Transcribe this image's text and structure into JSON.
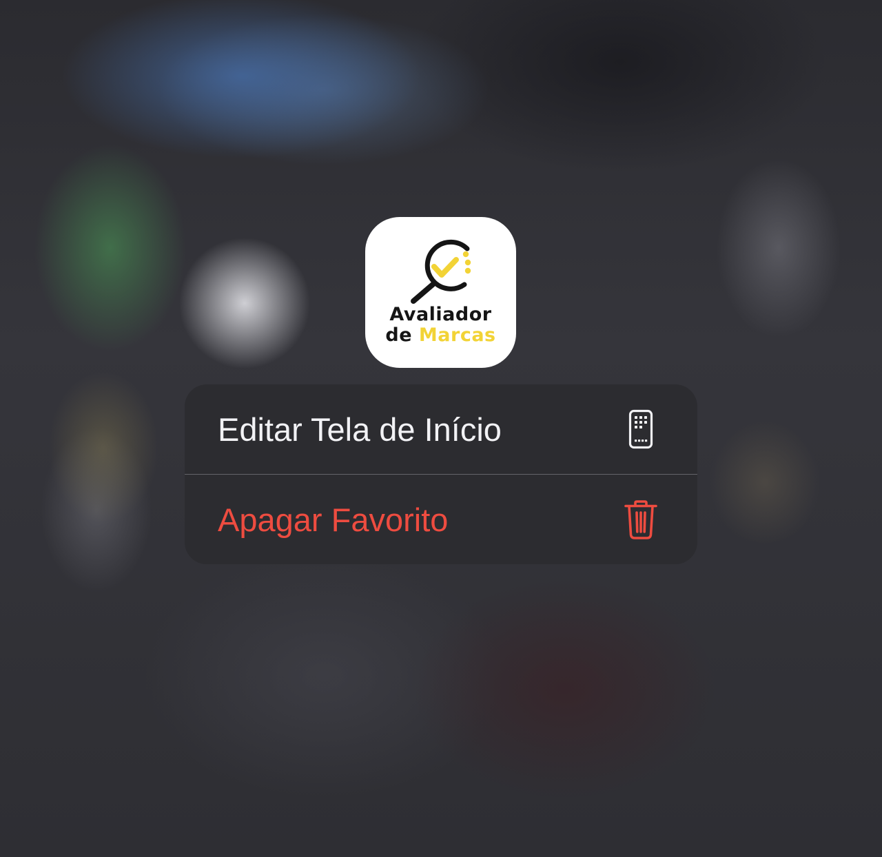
{
  "app": {
    "name_line1": "Avaliador",
    "name_line2_word1": "de",
    "name_line2_word2": "Marcas",
    "brand_colors": {
      "accent_yellow": "#f2d336",
      "dark": "#151515",
      "icon_background": "#ffffff"
    }
  },
  "context_menu": {
    "items": [
      {
        "label": "Editar Tela de Início",
        "icon": "home-screen-phone-icon",
        "color": "#f2f2f5"
      },
      {
        "label": "Apagar Favorito",
        "icon": "trash-icon",
        "color": "#ee4c40",
        "destructive": true
      }
    ],
    "background": "#2c2c30"
  }
}
